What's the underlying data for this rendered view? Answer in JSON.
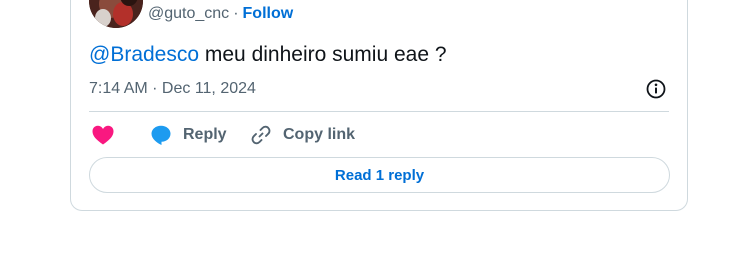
{
  "tweet": {
    "author_handle": "@guto_cnc",
    "separator": "·",
    "follow_label": "Follow",
    "mention": "@Bradesco",
    "text": " meu dinheiro sumiu eae ?",
    "time": "7:14 AM",
    "date": "Dec 11, 2024",
    "meta_separator": " · "
  },
  "actions": {
    "like_icon": "heart-icon",
    "reply_label": "Reply",
    "reply_icon": "speech-bubble-icon",
    "copy_link_label": "Copy link",
    "copy_link_icon": "link-icon"
  },
  "read_replies": {
    "label": "Read 1 reply"
  },
  "colors": {
    "accent": "#006fd6",
    "like": "#f91880",
    "reply_icon": "#1d9bf0",
    "muted": "#536471",
    "border": "#cfd9de"
  }
}
